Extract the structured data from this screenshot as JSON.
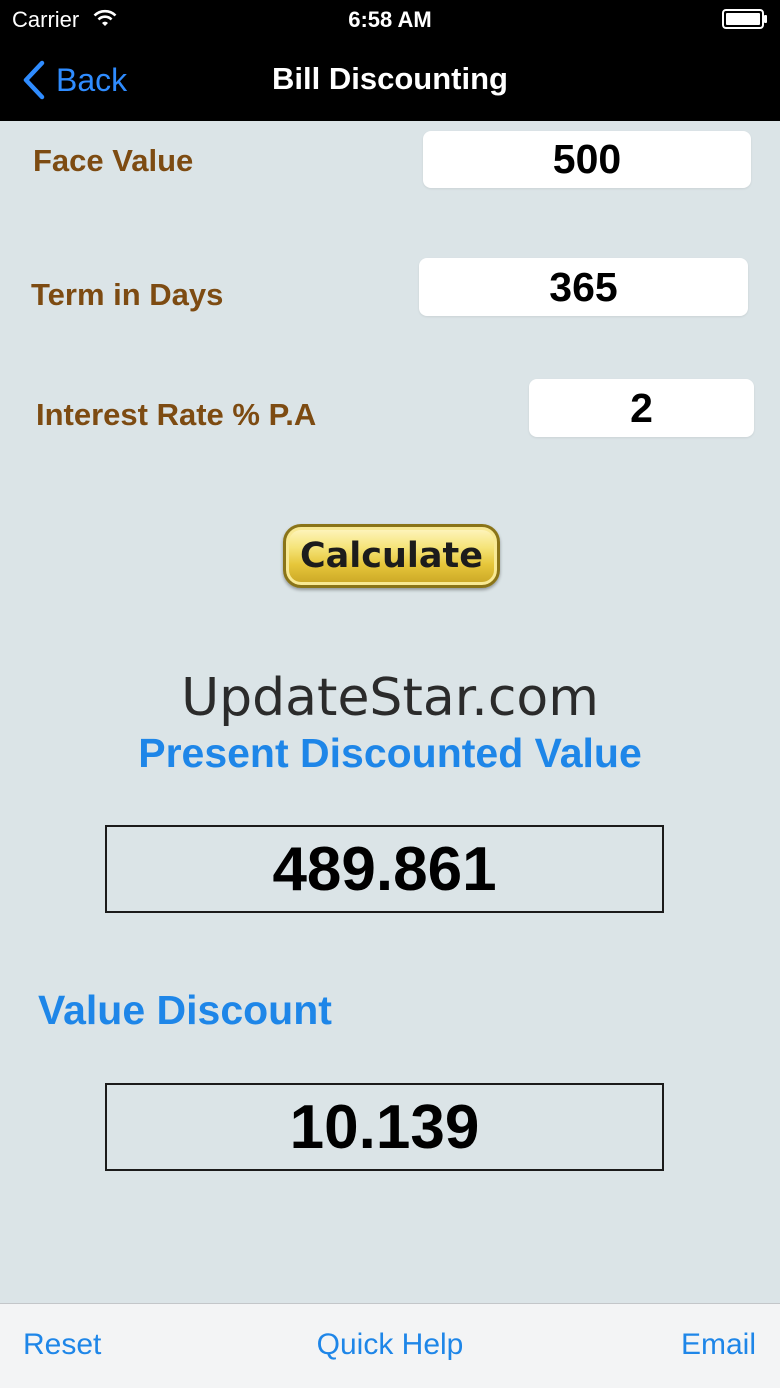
{
  "status_bar": {
    "carrier": "Carrier",
    "time": "6:58 AM",
    "wifi_icon": "wifi-icon",
    "battery_icon": "battery-icon"
  },
  "nav": {
    "back_label": "Back",
    "title": "Bill Discounting",
    "back_icon": "chevron-left-icon"
  },
  "form": {
    "face_value": {
      "label": "Face Value",
      "value": "500"
    },
    "term_days": {
      "label": "Term in Days",
      "value": "365"
    },
    "interest_rate": {
      "label": "Interest Rate % P.A",
      "value": "2"
    },
    "calculate_label": "Calculate"
  },
  "watermark": "UpdateStar.com",
  "results": {
    "present_value": {
      "label": "Present Discounted Value",
      "value": "489.861"
    },
    "value_discount": {
      "label": "Value Discount",
      "value": "10.139"
    }
  },
  "toolbar": {
    "reset_label": "Reset",
    "quick_help_label": "Quick Help",
    "email_label": "Email"
  },
  "colors": {
    "background": "#dbe4e7",
    "label_brown": "#7d4b12",
    "accent_blue": "#1e86e8",
    "nav_bar": "#000000",
    "button_gold": "#e6c63a"
  }
}
